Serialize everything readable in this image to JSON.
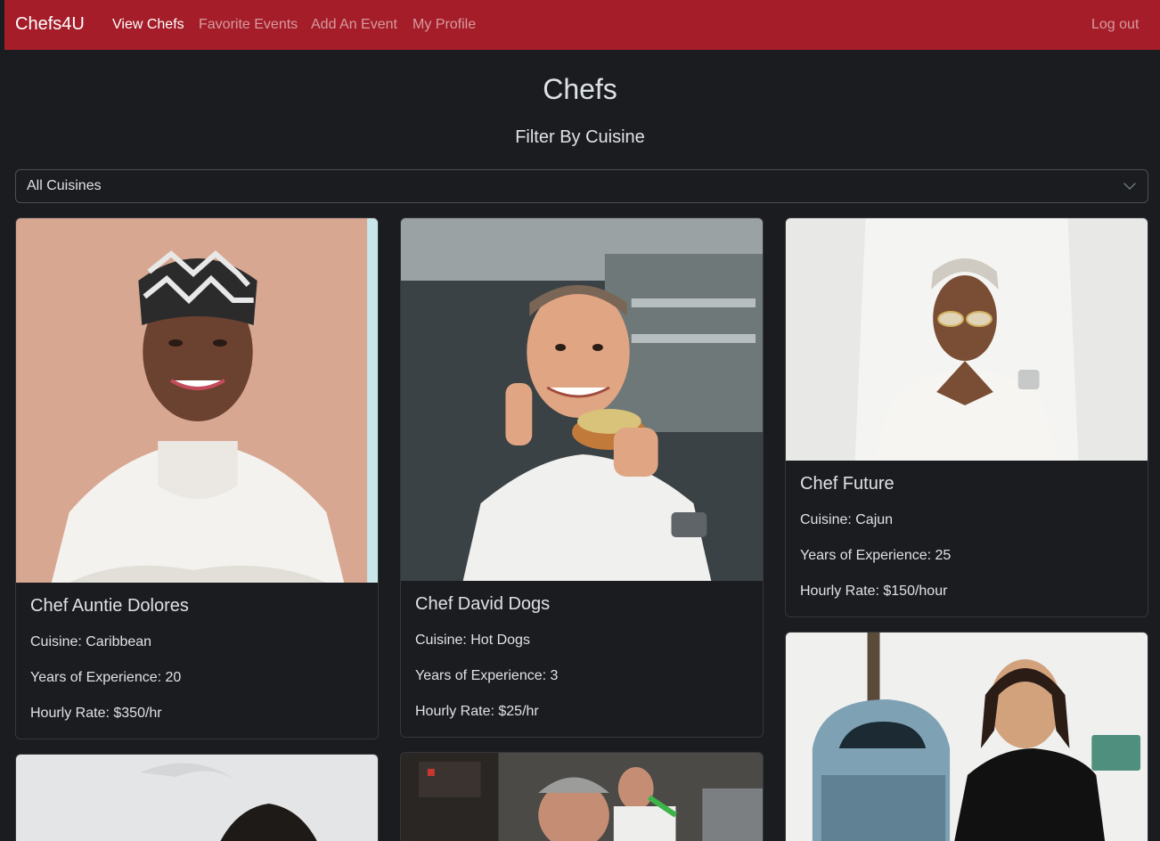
{
  "nav": {
    "brand": "Chefs4U",
    "links": [
      "View Chefs",
      "Favorite Events",
      "Add An Event",
      "My Profile"
    ],
    "logout": "Log out"
  },
  "page": {
    "title": "Chefs",
    "filter_label": "Filter By Cuisine"
  },
  "filter": {
    "selected": "All Cuisines"
  },
  "chefs": [
    {
      "name": "Chef Auntie Dolores",
      "cuisine": "Cuisine: Caribbean",
      "experience": "Years of Experience: 20",
      "rate": "Hourly Rate: $350/hr"
    },
    {
      "name": "Chef David Dogs",
      "cuisine": "Cuisine: Hot Dogs",
      "experience": "Years of Experience: 3",
      "rate": "Hourly Rate: $25/hr"
    },
    {
      "name": "Chef Future",
      "cuisine": "Cuisine: Cajun",
      "experience": "Years of Experience: 25",
      "rate": "Hourly Rate: $150/hour"
    }
  ],
  "colors": {
    "navbar": "#a41d29",
    "background": "#1b1c1f",
    "text": "#dee2e6",
    "card_border": "#34373b"
  },
  "icons": {
    "select": "chevron-down-icon"
  }
}
